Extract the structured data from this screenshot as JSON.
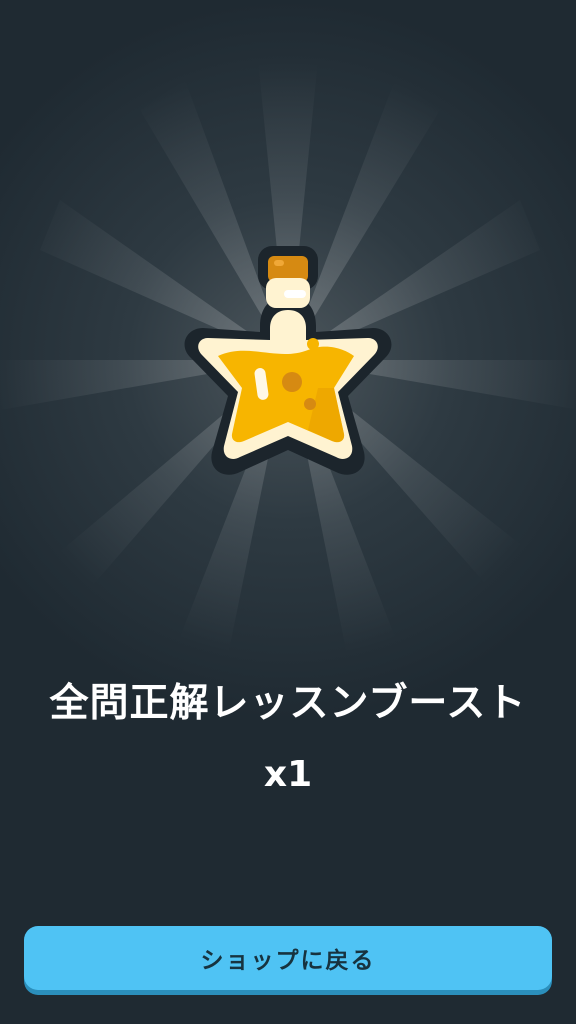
{
  "reward": {
    "title": "全問正解レッスンブースト",
    "quantity": "x1",
    "icon": "star-potion-icon"
  },
  "actions": {
    "back_to_shop_label": "ショップに戻る"
  },
  "colors": {
    "background": "#1f2a32",
    "button": "#4fc3f4",
    "button_text": "#17333f",
    "potion_liquid": "#f7b500",
    "potion_glass": "#fff3d1",
    "cork": "#d68a12"
  }
}
